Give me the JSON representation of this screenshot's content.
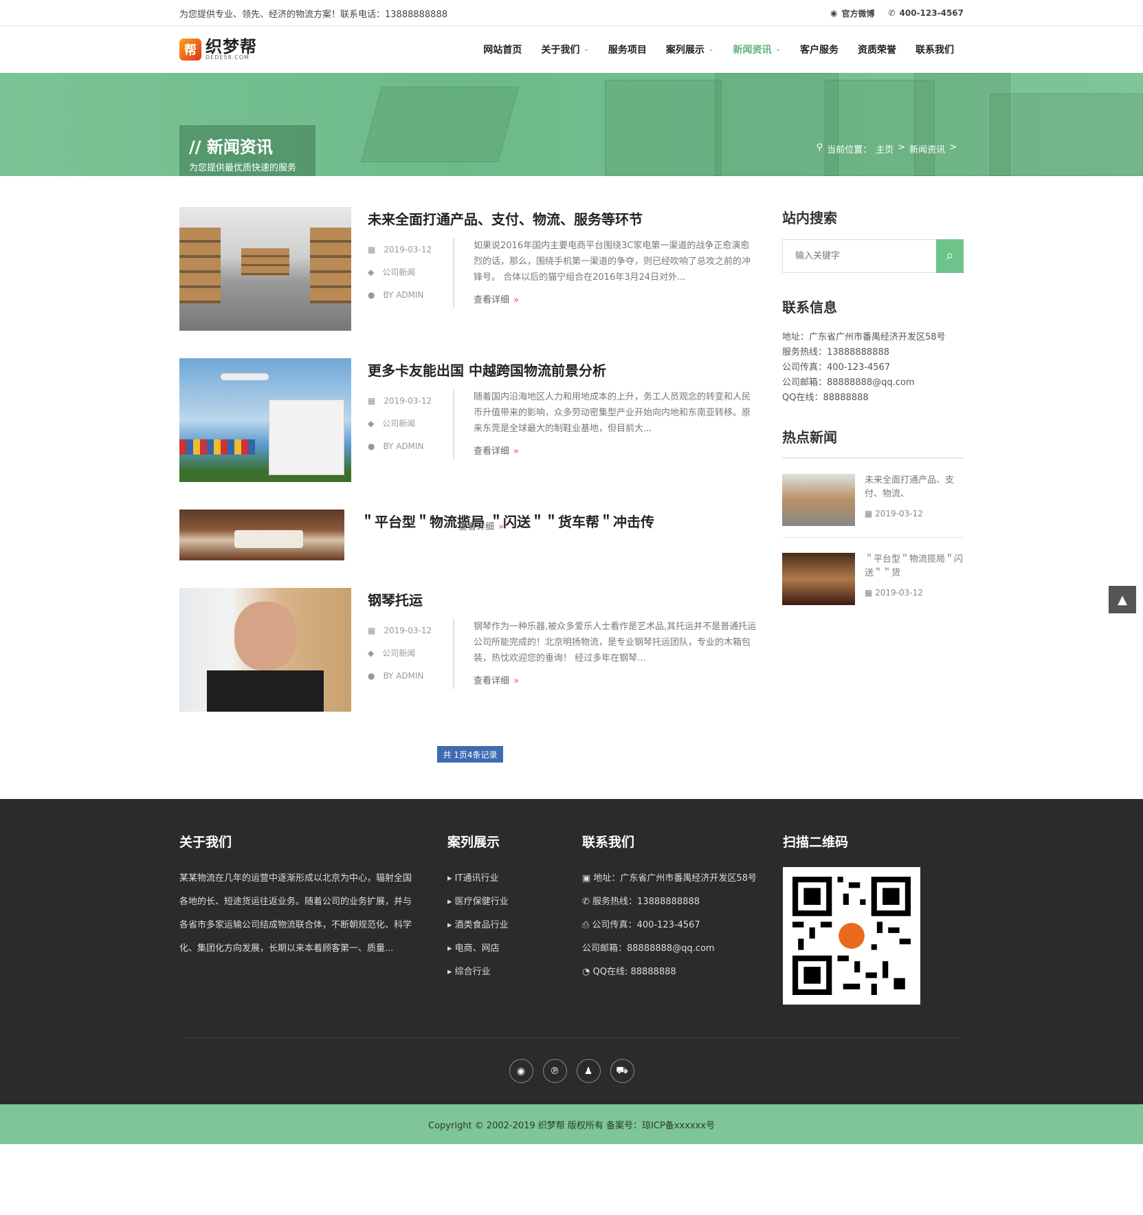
{
  "topbar": {
    "slogan": "为您提供专业、领先、经济的物流方案！联系电话：13888888888",
    "weibo": "官方微博",
    "phone": "400-123-4567"
  },
  "logo": {
    "mark": "帮",
    "name": "织梦帮",
    "sub": "DEDE58.COM"
  },
  "nav": [
    {
      "label": "网站首页",
      "dropdown": false,
      "active": false
    },
    {
      "label": "关于我们",
      "dropdown": true,
      "active": false
    },
    {
      "label": "服务项目",
      "dropdown": false,
      "active": false
    },
    {
      "label": "案列展示",
      "dropdown": true,
      "active": false
    },
    {
      "label": "新闻资讯",
      "dropdown": true,
      "active": true
    },
    {
      "label": "客户服务",
      "dropdown": false,
      "active": false
    },
    {
      "label": "资质荣誉",
      "dropdown": false,
      "active": false
    },
    {
      "label": "联系我们",
      "dropdown": false,
      "active": false
    }
  ],
  "banner": {
    "title": "// 新闻资讯",
    "subtitle": "为您提供最优质快速的服务",
    "crumb_label": "当前位置：",
    "crumb_home": "主页",
    "crumb_sep": ">",
    "crumb_current": "新闻资讯",
    "crumb_end": ">"
  },
  "articles": [
    {
      "title": "未来全面打通产品、支付、物流、服务等环节",
      "date": "2019-03-12",
      "category": "公司新闻",
      "author": "BY ADMIN",
      "excerpt": "如果说2016年国内主要电商平台围绕3C家电第一渠道的战争正愈演愈烈的话，那么，围绕手机第一渠道的争夺，则已经吹响了总攻之前的冲锋号。 合体以后的猫宁组合在2016年3月24日对外...",
      "more": "查看详细"
    },
    {
      "title": "更多卡友能出国 中越跨国物流前景分析",
      "date": "2019-03-12",
      "category": "公司新闻",
      "author": "BY ADMIN",
      "excerpt": "随着国内沿海地区人力和用地成本的上升，务工人员观念的转变和人民币升值带来的影响，众多劳动密集型产业开始向内地和东南亚转移。原来东莞是全球最大的制鞋业基地，但目前大...",
      "more": "查看详细"
    },
    {
      "title": "＂平台型＂物流揽局 ＂闪送＂＂货车帮＂冲击传",
      "more": "查看详细"
    },
    {
      "title": "钢琴托运",
      "date": "2019-03-12",
      "category": "公司新闻",
      "author": "BY ADMIN",
      "excerpt": "钢琴作为一种乐器,被众多爱乐人士看作是艺术品,其托运并不是普通托运公司所能完成的！北京明扬物流，是专业钢琴托运团队，专业的木箱包装，热忱欢迎您的垂询！ 经过多年在钢琴...",
      "more": "查看详细"
    }
  ],
  "pager": "共 1页4条记录",
  "sidebar": {
    "search_title": "站内搜索",
    "search_placeholder": "输入关键字",
    "contact_title": "联系信息",
    "contact": [
      "地址：广东省广州市番禺经济开发区58号",
      "服务热线：13888888888",
      "公司传真：400-123-4567",
      "公司邮箱：88888888@qq.com",
      "QQ在线：88888888"
    ],
    "hot_title": "热点新闻",
    "hot": [
      {
        "title": "未来全面打通产品、支付、物流、",
        "date": "2019-03-12"
      },
      {
        "title": "＂平台型＂物流揽局＂闪送＂＂货",
        "date": "2019-03-12"
      }
    ]
  },
  "footer": {
    "about_title": "关于我们",
    "about_text": "某某物流在几年的运营中逐渐形成以北京为中心，辐射全国各地的长、短途货运往返业务。随着公司的业务扩展，并与各省市多家运输公司结成物流联合体，不断朝规范化、科学化、集团化方向发展，长期以来本着顾客第一、质量...",
    "cases_title": "案列展示",
    "cases": [
      "IT通讯行业",
      "医疗保健行业",
      "酒类食品行业",
      "电商、网店",
      "综合行业"
    ],
    "contact_title": "联系我们",
    "contact": [
      "地址：广东省广州市番禺经济开发区58号",
      "服务热线：13888888888",
      "公司传真：400-123-4567",
      "公司邮箱：88888888@qq.com",
      "QQ在线: 88888888"
    ],
    "qr_title": "扫描二维码",
    "copyright": "Copyright © 2002-2019 织梦帮 版权所有 备案号：琼ICP备xxxxxx号"
  }
}
